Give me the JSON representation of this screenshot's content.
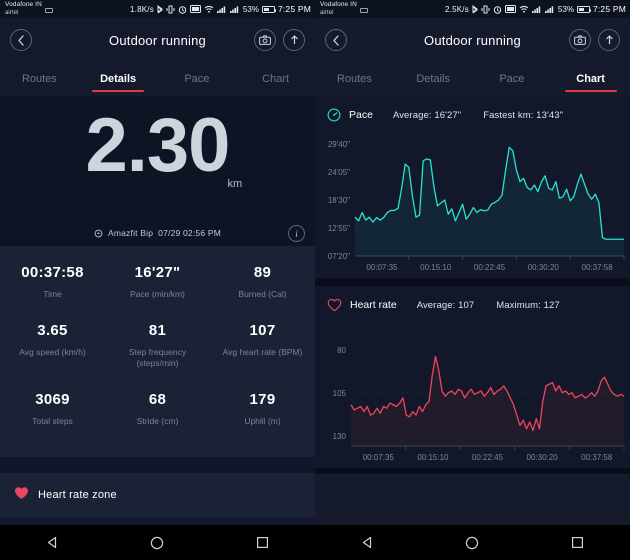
{
  "left": {
    "statusbar": {
      "carrier_line1": "Vodafone IN",
      "carrier_line2": "airtel",
      "net_speed": "1.8K/s",
      "battery_pct": "53%",
      "time": "7:25 PM",
      "icons": [
        "sim-card-icon",
        "bluetooth-icon",
        "vibrate-icon",
        "alarm-icon",
        "nfc-icon",
        "wifi-icon",
        "signal-icon",
        "signal-icon",
        "battery-icon"
      ]
    },
    "header": {
      "back_icon": "chevron-left-icon",
      "title": "Outdoor running",
      "camera_icon": "camera-icon",
      "share_icon": "share-upload-icon"
    },
    "tabs": [
      {
        "label": "Routes",
        "active": false
      },
      {
        "label": "Details",
        "active": true
      },
      {
        "label": "Pace",
        "active": false
      },
      {
        "label": "Chart",
        "active": false
      }
    ],
    "hero": {
      "distance": "2.30",
      "unit": "km",
      "device_icon": "watch-icon",
      "device": "Amazfit Bip",
      "datetime": "07/29 02:56 PM",
      "info_icon": "info-icon",
      "info_label": "i"
    },
    "stats": [
      {
        "value": "00:37:58",
        "label": "Time"
      },
      {
        "value": "16'27\"",
        "label": "Pace (min/km)"
      },
      {
        "value": "89",
        "label": "Burned (Cal)"
      },
      {
        "value": "3.65",
        "label": "Avg speed (km/h)"
      },
      {
        "value": "81",
        "label": "Step frequency (steps/min)"
      },
      {
        "value": "107",
        "label": "Avg heart rate (BPM)"
      },
      {
        "value": "3069",
        "label": "Total steps"
      },
      {
        "value": "68",
        "label": "Stride (cm)"
      },
      {
        "value": "179",
        "label": "Uphill (m)"
      }
    ],
    "heart_rate_zone": {
      "icon": "heart-filled-icon",
      "label": "Heart rate zone",
      "color": "#e8475f"
    },
    "navbar": {
      "back_icon": "triangle-back-icon",
      "home_icon": "circle-home-icon",
      "recents_icon": "square-recents-icon"
    }
  },
  "right": {
    "statusbar": {
      "carrier_line1": "Vodafone IN",
      "carrier_line2": "airtel",
      "net_speed": "2.5K/s",
      "battery_pct": "53%",
      "time": "7:25 PM"
    },
    "header": {
      "back_icon": "chevron-left-icon",
      "title": "Outdoor running",
      "camera_icon": "camera-icon",
      "share_icon": "share-upload-icon"
    },
    "tabs": [
      {
        "label": "Routes",
        "active": false
      },
      {
        "label": "Details",
        "active": false
      },
      {
        "label": "Pace",
        "active": false
      },
      {
        "label": "Chart",
        "active": true
      }
    ],
    "pace_card": {
      "icon": "speedometer-icon",
      "name": "Pace",
      "metric1": "Average: 16'27\"",
      "metric2": "Fastest km: 13'43\"",
      "color": "#2ae0d5"
    },
    "hr_card": {
      "icon": "heart-outline-icon",
      "name": "Heart rate",
      "metric1": "Average: 107",
      "metric2": "Maximum: 127",
      "color": "#ef4559"
    }
  },
  "chart_data": [
    {
      "type": "line",
      "title": "Pace",
      "xlabel": "",
      "ylabel": "Pace (min/km)",
      "ytick_labels": [
        "07'20\"",
        "12'55\"",
        "18'30\"",
        "24'05\"",
        "29'40\""
      ],
      "ytick_values": [
        440,
        775,
        1110,
        1445,
        1780
      ],
      "ylim": [
        1780,
        440
      ],
      "yaxis_inverted": true,
      "xtick_labels": [
        "00:07:35",
        "00:15:10",
        "00:22:45",
        "00:30:20",
        "00:37:58"
      ],
      "grid": true,
      "legend": null,
      "series_color": "#2ae0d5",
      "annotations": {
        "average": "16'27\"",
        "fastest_km": "13'43\""
      },
      "values_seconds": [
        905,
        860,
        960,
        870,
        905,
        845,
        900,
        870,
        900,
        960,
        985,
        985,
        1010,
        1250,
        1540,
        1500,
        1160,
        905,
        930,
        1580,
        1600,
        1590,
        1270,
        1040,
        1075,
        1110,
        940,
        1005,
        860,
        960,
        1060,
        880,
        940,
        1020,
        960,
        995,
        980,
        990,
        1060,
        1080,
        1110,
        1170,
        1470,
        1740,
        1700,
        1470,
        1330,
        1370,
        1260,
        1230,
        1290,
        1210,
        1330,
        1400,
        1250,
        1230,
        1330,
        1130,
        1150,
        1240,
        1100,
        1150,
        1300,
        1420,
        1300,
        1180,
        1120,
        1180,
        1080,
        660,
        640,
        640,
        640,
        640,
        640,
        640
      ]
    },
    {
      "type": "line",
      "title": "Heart rate",
      "xlabel": "",
      "ylabel": "BPM",
      "ytick_labels": [
        "130",
        "105",
        "80"
      ],
      "ytick_values": [
        130,
        105,
        80
      ],
      "ylim": [
        72,
        136
      ],
      "xtick_labels": [
        "00:07:35",
        "00:15:10",
        "00:22:45",
        "00:30:20",
        "00:37:58"
      ],
      "grid": true,
      "legend": null,
      "series_color": "#ef4559",
      "annotations": {
        "average": "107",
        "maximum": "127"
      },
      "values_bpm": [
        112,
        115,
        114,
        113,
        116,
        113,
        118,
        117,
        114,
        117,
        113,
        114,
        111,
        112,
        113,
        111,
        108,
        118,
        119,
        116,
        118,
        113,
        116,
        112,
        110,
        95,
        84,
        92,
        104,
        107,
        105,
        104,
        106,
        103,
        104,
        108,
        105,
        103,
        106,
        105,
        104,
        107,
        105,
        102,
        106,
        104,
        103,
        101,
        104,
        108,
        112,
        118,
        124,
        121,
        126,
        122,
        127,
        120,
        126,
        110,
        101,
        100,
        99,
        104,
        101,
        105,
        104,
        106,
        105,
        108,
        107,
        106,
        108,
        107,
        105,
        107,
        104,
        98,
        96,
        100,
        104,
        106,
        107,
        106,
        107
      ]
    }
  ]
}
